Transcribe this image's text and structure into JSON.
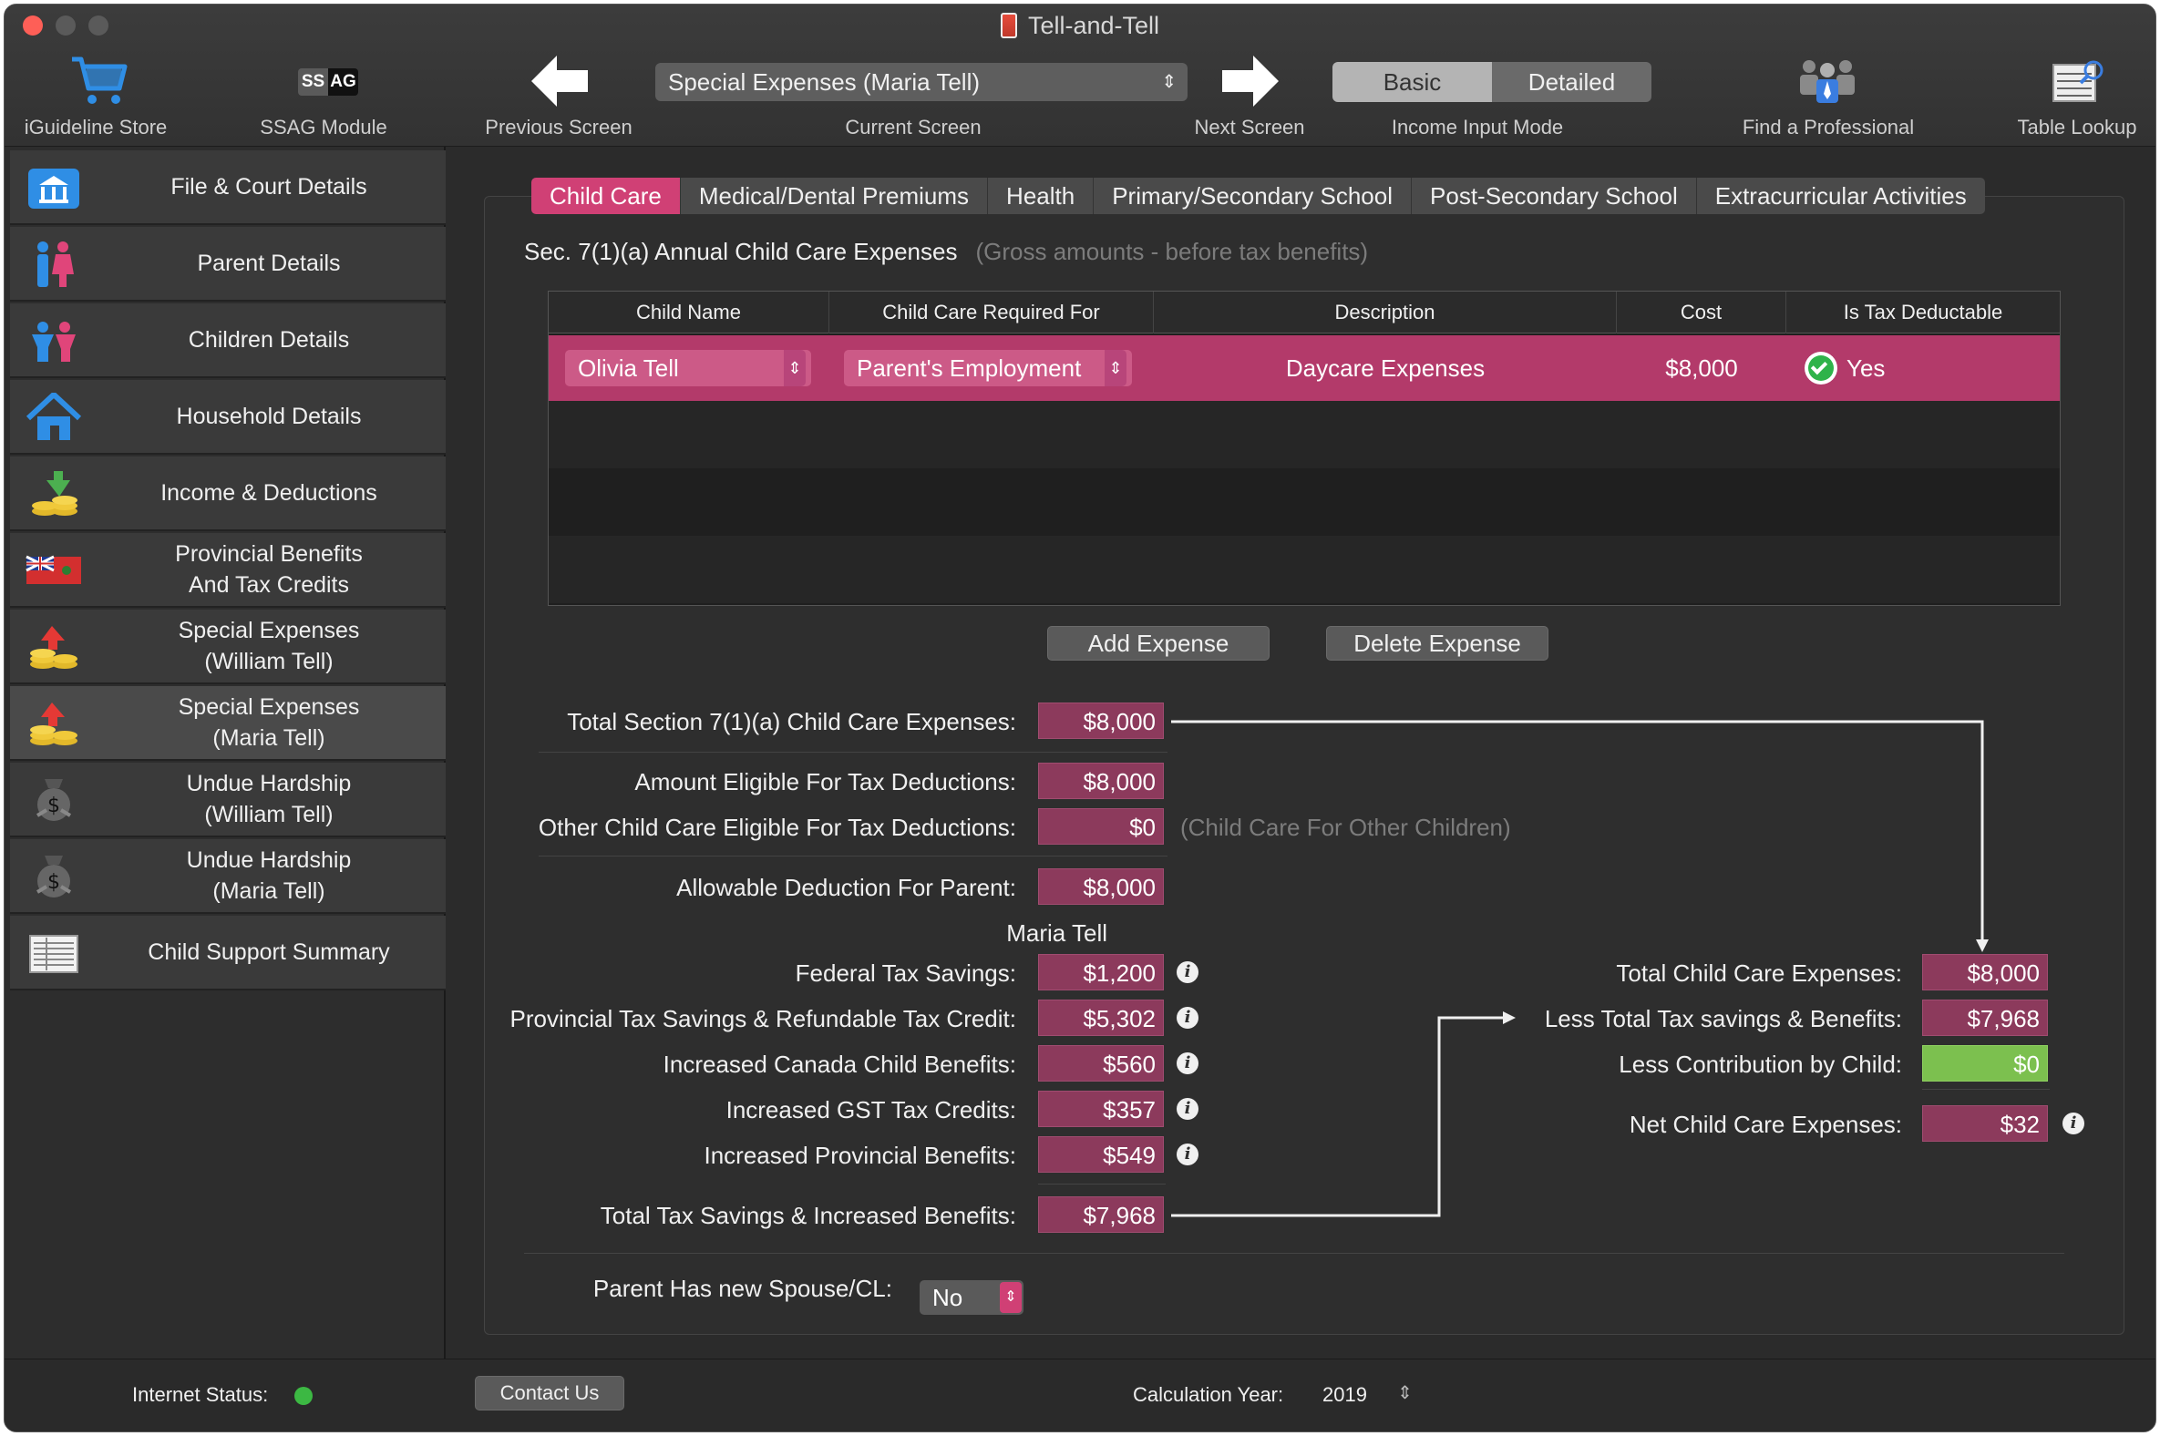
{
  "window": {
    "title": "Tell-and-Tell"
  },
  "toolbar": {
    "store_label": "iGuideline Store",
    "ssag": {
      "ss": "SS",
      "ag": "AG",
      "label": "SSAG Module"
    },
    "previous_label": "Previous Screen",
    "current_screen": {
      "value": "Special Expenses (Maria Tell)",
      "label": "Current Screen"
    },
    "next_label": "Next Screen",
    "income_mode": {
      "basic": "Basic",
      "detailed": "Detailed",
      "selected": "Basic",
      "label": "Income Input Mode"
    },
    "professional_label": "Find a Professional",
    "table_lookup_label": "Table Lookup"
  },
  "sidebar": {
    "items": [
      {
        "label": "File & Court Details",
        "icon": "courthouse-icon"
      },
      {
        "label": "Parent Details",
        "icon": "parents-icon"
      },
      {
        "label": "Children Details",
        "icon": "children-icon"
      },
      {
        "label": "Household Details",
        "icon": "house-icon"
      },
      {
        "label": "Income & Deductions",
        "icon": "coins-arrow-icon"
      },
      {
        "label": "Provincial Benefits\nAnd Tax Credits",
        "icon": "ontario-flag-icon"
      },
      {
        "label": "Special Expenses\n(William Tell)",
        "icon": "coins-up-arrow-icon"
      },
      {
        "label": "Special Expenses\n(Maria Tell)",
        "icon": "coins-up-arrow-icon"
      },
      {
        "label": "Undue Hardship\n(William Tell)",
        "icon": "money-bag-icon"
      },
      {
        "label": "Undue Hardship\n(Maria Tell)",
        "icon": "money-bag-icon"
      },
      {
        "label": "Child Support Summary",
        "icon": "ledger-icon"
      }
    ],
    "active_index": 7
  },
  "tabs": [
    "Child Care",
    "Medical/Dental Premiums",
    "Health",
    "Primary/Secondary School",
    "Post-Secondary School",
    "Extracurricular Activities"
  ],
  "section": {
    "title": "Sec. 7(1)(a) Annual Child Care Expenses",
    "note": "(Gross amounts - before tax benefits)"
  },
  "table": {
    "columns": [
      "Child Name",
      "Child Care Required For",
      "Description",
      "Cost",
      "Is Tax Deductable"
    ],
    "rows": [
      {
        "child_name": "Olivia Tell",
        "required_for": "Parent's Employment",
        "description": "Daycare Expenses",
        "cost": "$8,000",
        "tax_deductible": "Yes"
      }
    ]
  },
  "buttons": {
    "add": "Add Expense",
    "delete": "Delete Expense"
  },
  "summary": {
    "total_section": {
      "label": "Total Section 7(1)(a) Child Care Expenses:",
      "value": "$8,000"
    },
    "eligible": {
      "label": "Amount Eligible For Tax Deductions:",
      "value": "$8,000"
    },
    "other": {
      "label": "Other Child Care Eligible For Tax Deductions:",
      "value": "$0",
      "note": "(Child Care For Other Children)"
    },
    "allowable": {
      "label": "Allowable Deduction For Parent:",
      "value": "$8,000"
    },
    "parent_name": "Maria Tell",
    "federal": {
      "label": "Federal Tax Savings:",
      "value": "$1,200"
    },
    "provincial": {
      "label": "Provincial Tax Savings & Refundable Tax Credit:",
      "value": "$5,302"
    },
    "ccb": {
      "label": "Increased Canada Child Benefits:",
      "value": "$560"
    },
    "gst": {
      "label": "Increased GST Tax Credits:",
      "value": "$357"
    },
    "prov_benefits": {
      "label": "Increased Provincial Benefits:",
      "value": "$549"
    },
    "total_savings": {
      "label": "Total Tax Savings & Increased Benefits:",
      "value": "$7,968"
    }
  },
  "right_summary": {
    "total": {
      "label": "Total Child Care Expenses:",
      "value": "$8,000"
    },
    "less_savings": {
      "label": "Less Total Tax savings & Benefits:",
      "value": "$7,968"
    },
    "less_child": {
      "label": "Less Contribution by Child:",
      "value": "$0"
    },
    "net": {
      "label": "Net Child Care Expenses:",
      "value": "$32"
    }
  },
  "spouse": {
    "label": "Parent Has new Spouse/CL:",
    "value": "No"
  },
  "status": {
    "internet_label": "Internet Status:",
    "internet_color": "#3cb843",
    "contact_label": "Contact Us",
    "calc_year_label": "Calculation Year:",
    "calc_year": "2019"
  },
  "colors": {
    "accent": "#d04075",
    "row_selected": "#b33a6a",
    "value_field": "#8c3a5c",
    "positive_field": "#7cc04f"
  }
}
